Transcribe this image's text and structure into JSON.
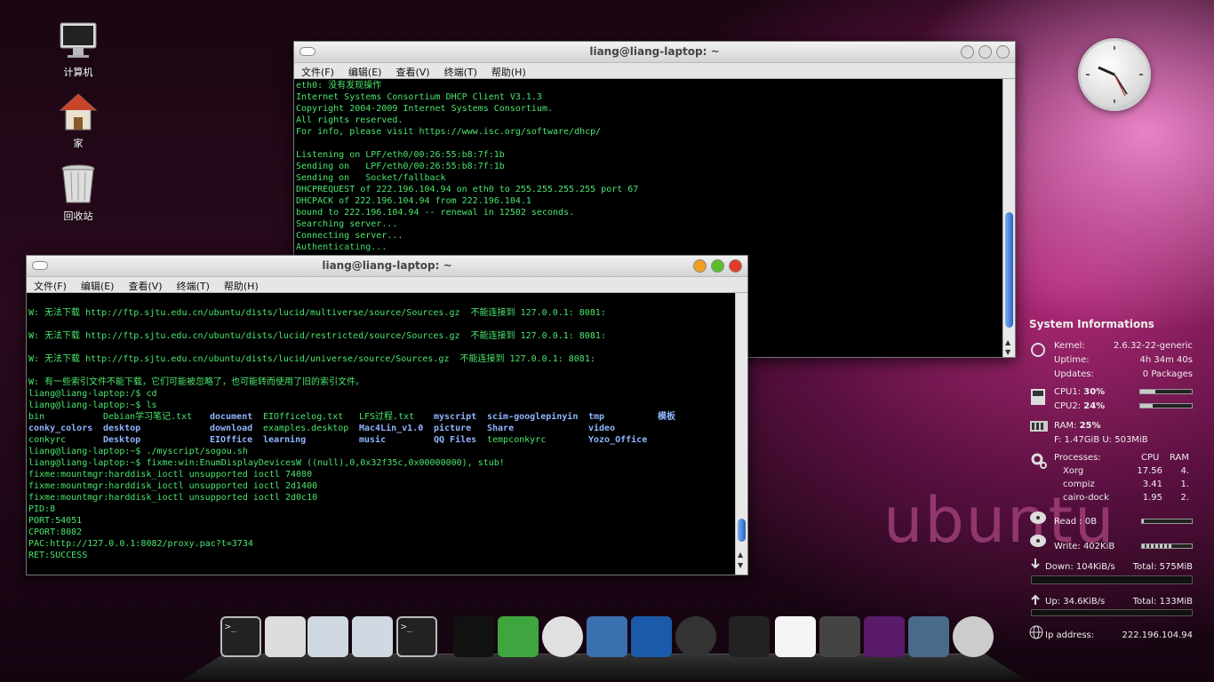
{
  "desktop": {
    "icons": [
      {
        "label": "计算机",
        "icon": "computer-icon"
      },
      {
        "label": "家",
        "icon": "home-icon"
      },
      {
        "label": "回收站",
        "icon": "trash-icon"
      }
    ]
  },
  "window_back": {
    "title": "liang@liang-laptop: ~",
    "menu": [
      "文件(F)",
      "编辑(E)",
      "查看(V)",
      "终端(T)",
      "帮助(H)"
    ],
    "lines": [
      "eth0: 没有发现操作",
      "Internet Systems Consortium DHCP Client V3.1.3",
      "Copyright 2004-2009 Internet Systems Consortium.",
      "All rights reserved.",
      "For info, please visit https://www.isc.org/software/dhcp/",
      "",
      "Listening on LPF/eth0/00:26:55:b8:7f:1b",
      "Sending on   LPF/eth0/00:26:55:b8:7f:1b",
      "Sending on   Socket/fallback",
      "DHCPREQUEST of 222.196.104.94 on eth0 to 255.255.255.255 port 67",
      "DHCPACK of 222.196.104.94 from 222.196.104.1",
      "bound to 222.196.104.94 -- renewal in 12502 seconds.",
      "Searching server...",
      "Connecting server...",
      "Authenticating..."
    ]
  },
  "window_front": {
    "title": "liang@liang-laptop: ~",
    "menu": [
      "文件(F)",
      "编辑(E)",
      "查看(V)",
      "终端(T)",
      "帮助(H)"
    ],
    "lines_top": [
      "W: 无法下载 http://ftp.sjtu.edu.cn/ubuntu/dists/lucid/multiverse/source/Sources.gz  不能连接到 127.0.0.1: 8081:",
      "",
      "W: 无法下载 http://ftp.sjtu.edu.cn/ubuntu/dists/lucid/restricted/source/Sources.gz  不能连接到 127.0.0.1: 8081:",
      "",
      "W: 无法下载 http://ftp.sjtu.edu.cn/ubuntu/dists/lucid/universe/source/Sources.gz  不能连接到 127.0.0.1: 8081:",
      "",
      "W: 有一些索引文件不能下载，它们可能被忽略了，也可能转而使用了旧的索引文件。",
      "liang@liang-laptop:/$ cd",
      "liang@liang-laptop:~$ ls"
    ],
    "ls": [
      [
        "bin",
        "Debian学习笔记.txt",
        "document",
        "EIOfficelog.txt",
        "LFS过程.txt",
        "myscript",
        "scim-googlepinyin",
        "tmp",
        "模板"
      ],
      [
        "conky_colors",
        "desktop",
        "download",
        "examples.desktop",
        "Mac4Lin_v1.0",
        "picture",
        "Share",
        "video",
        ""
      ],
      [
        "conkyrc",
        "Desktop",
        "EIOffice",
        "learning",
        "music",
        "QQ Files",
        "tempconkyrc",
        "Yozo_Office",
        ""
      ]
    ],
    "lines_bottom": [
      "liang@liang-laptop:~$ ./myscript/sogou.sh",
      "liang@liang-laptop:~$ fixme:win:EnumDisplayDevicesW ((null),0,0x32f35c,0x00000000), stub!",
      "fixme:mountmgr:harddisk_ioctl unsupported ioctl 74080",
      "fixme:mountmgr:harddisk_ioctl unsupported ioctl 2d1400",
      "fixme:mountmgr:harddisk_ioctl unsupported ioctl 2d0c10",
      "PID:8",
      "PORT:54051",
      "CPORT:8082",
      "PAC:http://127.0.0.1:8082/proxy.pac?t=3734",
      "RET:SUCCESS"
    ]
  },
  "conky": {
    "title": "System Informations",
    "kernel_label": "Kernel:",
    "kernel": "2.6.32-22-generic",
    "uptime_label": "Uptime:",
    "uptime": "4h 34m 40s",
    "updates_label": "Updates:",
    "updates": "0 Packages",
    "cpu1_label": "CPU1:",
    "cpu1": "30%",
    "cpu1_level": 0.3,
    "cpu2_label": "CPU2:",
    "cpu2": "24%",
    "cpu2_level": 0.24,
    "ram_label": "RAM:",
    "ram": "25%",
    "ram_detail": "F: 1.47GiB U: 503MiB",
    "proc_label": "Processes:",
    "proc_cpu": "CPU",
    "proc_ram": "RAM",
    "procs": [
      {
        "name": "Xorg",
        "cpu": "17.56",
        "ram": "4."
      },
      {
        "name": "compiz",
        "cpu": "3.41",
        "ram": "1."
      },
      {
        "name": "cairo-dock",
        "cpu": "1.95",
        "ram": "2."
      }
    ],
    "read": "Read : 0B",
    "write": "Write: 402KiB",
    "down": "Down: 104KiB/s",
    "down_total": "Total: 575MiB",
    "up": "Up: 34.6KiB/s",
    "up_total": "Total: 133MiB",
    "ip_label": "Ip address:",
    "ip": "222.196.104.94"
  },
  "watermark": "ubuntu",
  "dock": {
    "items": [
      "terminal-icon",
      "screenshot-icon",
      "window-thumb-icon",
      "window-thumb-icon",
      "terminal-icon",
      "qq-icon",
      "mail-icon",
      "chrome-icon",
      "virtualbox-icon",
      "aurora-icon",
      "camera-icon",
      "gimp-icon",
      "document-icon",
      "speaker-icon",
      "workspace-icon",
      "monitor-icon",
      "power-icon"
    ]
  }
}
